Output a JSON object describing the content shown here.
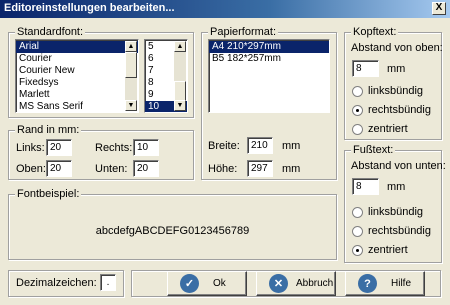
{
  "window": {
    "title": "Editoreinstellungen bearbeiten...",
    "close_glyph": "X"
  },
  "standardfont": {
    "label": "Standardfont:",
    "fonts": [
      "Arial",
      "Courier",
      "Courier New",
      "Fixedsys",
      "Marlett",
      "MS Sans Serif"
    ],
    "selected_font": "Arial",
    "sizes": [
      "5",
      "6",
      "7",
      "8",
      "9",
      "10"
    ],
    "selected_size": "10"
  },
  "papierformat": {
    "label": "Papierformat:",
    "items": [
      "A4 210*297mm",
      "B5 182*257mm"
    ],
    "selected": "A4 210*297mm",
    "breite_label": "Breite:",
    "breite_value": "210",
    "hoehe_label": "Höhe:",
    "hoehe_value": "297",
    "unit": "mm"
  },
  "kopftext": {
    "label": "Kopftext:",
    "abstand_label": "Abstand von oben:",
    "abstand_value": "8",
    "unit": "mm",
    "options": [
      "linksbündig",
      "rechtsbündig",
      "zentriert"
    ],
    "selected": "rechtsbündig"
  },
  "fusstext": {
    "label": "Fußtext:",
    "abstand_label": "Abstand von unten:",
    "abstand_value": "8",
    "unit": "mm",
    "options": [
      "linksbündig",
      "rechtsbündig",
      "zentriert"
    ],
    "selected": "zentriert"
  },
  "rand": {
    "label": "Rand in mm:",
    "links_label": "Links:",
    "links_value": "20",
    "rechts_label": "Rechts:",
    "rechts_value": "10",
    "oben_label": "Oben:",
    "oben_value": "20",
    "unten_label": "Unten:",
    "unten_value": "20"
  },
  "fontbeispiel": {
    "label": "Fontbeispiel:",
    "sample": "abcdefgABCDEFG0123456789"
  },
  "dezimal": {
    "label": "Dezimalzeichen:",
    "value": "."
  },
  "buttons": {
    "ok": "Ok",
    "abbruch": "Abbruch",
    "hilfe": "Hilfe"
  },
  "colors": {
    "title_start": "#0a246a",
    "selection": "#0a246a",
    "dialog_bg": "#ece9d8"
  }
}
